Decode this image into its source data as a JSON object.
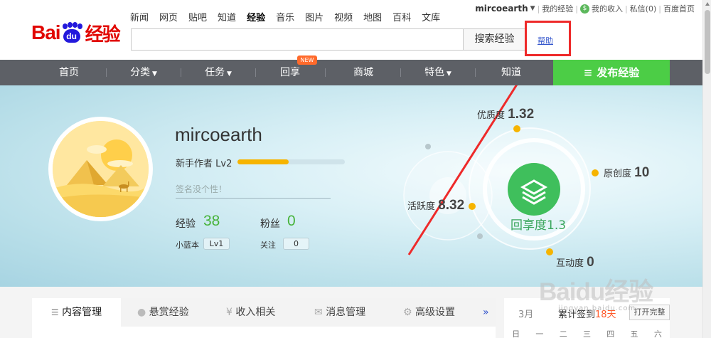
{
  "logo": {
    "text_bai": "Bai",
    "text_du": "du",
    "text_jingyan": "经验"
  },
  "top_nav": [
    "新闻",
    "网页",
    "贴吧",
    "知道",
    "经验",
    "音乐",
    "图片",
    "视频",
    "地图",
    "百科",
    "文库"
  ],
  "top_nav_active": "经验",
  "user_links": {
    "username": "mircoearth",
    "my_experience": "我的经验",
    "my_income": "我的收入",
    "messages": "私信(0)",
    "baidu_home": "百度首页"
  },
  "search": {
    "value": "",
    "button": "搜索经验",
    "help": "帮助"
  },
  "main_nav": {
    "items": [
      "首页",
      "分类",
      "任务",
      "回享",
      "商城",
      "特色",
      "知道"
    ],
    "new_badge": "NEW",
    "publish": "发布经验"
  },
  "profile": {
    "name": "mircoearth",
    "level_text": "新手作者 Lv2",
    "level_progress": 0.48,
    "signature_placeholder": "签名没个性！",
    "experience_label": "经验",
    "experience_value": "38",
    "fans_label": "粉丝",
    "fans_value": "0",
    "blue_label": "小蓝本",
    "blue_value": "Lv1",
    "follow_label": "关注",
    "follow_value": "0"
  },
  "scores": {
    "quality_label": "优质度",
    "quality_value": "1.32",
    "originality_label": "原创度",
    "originality_value": "10",
    "activity_label": "活跃度",
    "activity_value": "8.32",
    "interaction_label": "互动度",
    "interaction_value": "0",
    "share_label": "回享度1.3"
  },
  "tabs": [
    "内容管理",
    "悬赏经验",
    "收入相关",
    "消息管理",
    "高级设置"
  ],
  "calendar": {
    "month": "3月",
    "sign_prefix": "累计签到",
    "sign_days": "18天",
    "open_button": "打开完整",
    "weekdays": [
      "日",
      "一",
      "二",
      "三",
      "四",
      "五",
      "六"
    ]
  },
  "watermark": {
    "text": "Baidu经验",
    "url": "jingyan.baidu.com"
  },
  "colors": {
    "brand_red": "#e10601",
    "nav_bg": "#5d6066",
    "publish_green": "#4ccd46",
    "accent_gold": "#f6b400",
    "score_green": "#47b33a",
    "annotation_red": "#ee2a2a"
  }
}
